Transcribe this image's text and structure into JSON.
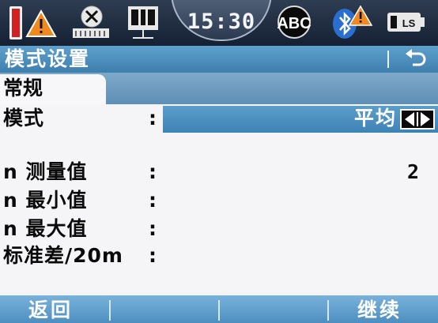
{
  "statusbar": {
    "time": "15:30",
    "icons": [
      "battery-warning-icon",
      "level-bubble-icon",
      "edm-icon",
      "compensator-abc-icon",
      "bluetooth-warning-icon",
      "battery-ls-icon"
    ]
  },
  "titlebar": {
    "title": "模式设置"
  },
  "tabs": [
    {
      "label": "常规",
      "active": true
    }
  ],
  "fields": {
    "mode": {
      "label": "模式",
      "value": "平均"
    },
    "n_measurements": {
      "label": "n 测量值",
      "value": "2"
    },
    "n_min": {
      "label": "n 最小值",
      "value": ""
    },
    "n_max": {
      "label": "n 最大值",
      "value": ""
    },
    "std_dev": {
      "label": "标准差/20m",
      "value": ""
    },
    "colon": ":"
  },
  "softkeys": {
    "back": "返回",
    "continue": "继续"
  },
  "colors": {
    "statusbar": "#1f2b3e",
    "titlebar": "#4a8bbb",
    "softbar": "#5f9fcc",
    "background": "#f5f5f7"
  }
}
